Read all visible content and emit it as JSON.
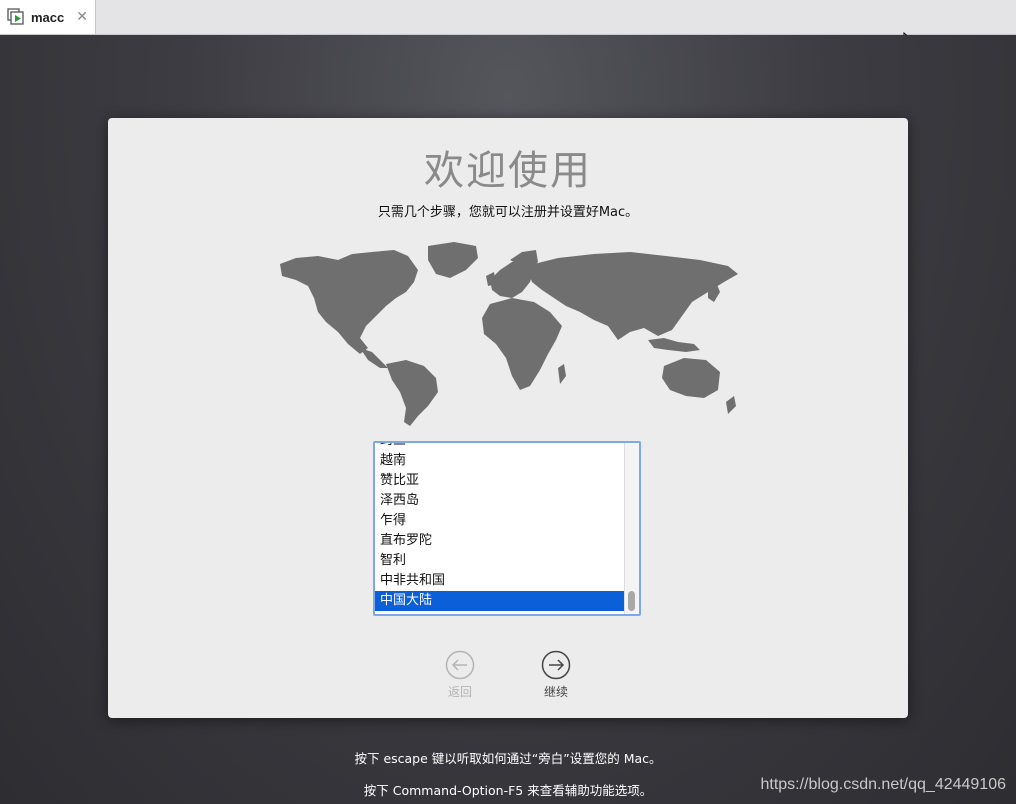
{
  "tab": {
    "title": "macc",
    "close": "✕"
  },
  "panel": {
    "title": "欢迎使用",
    "subtitle": "只需几个步骤，您就可以注册并设置好Mac。"
  },
  "countries": [
    {
      "label": "约旦",
      "selected": false
    },
    {
      "label": "越南",
      "selected": false
    },
    {
      "label": "赞比亚",
      "selected": false
    },
    {
      "label": "泽西岛",
      "selected": false
    },
    {
      "label": "乍得",
      "selected": false
    },
    {
      "label": "直布罗陀",
      "selected": false
    },
    {
      "label": "智利",
      "selected": false
    },
    {
      "label": "中非共和国",
      "selected": false
    },
    {
      "label": "中国大陆",
      "selected": true
    }
  ],
  "nav": {
    "back_label": "返回",
    "next_label": "继续"
  },
  "hints": {
    "line1": "按下 escape 键以听取如何通过“旁白”设置您的 Mac。",
    "line2": "按下 Command-Option-F5 来查看辅助功能选项。"
  },
  "watermark": "https://blog.csdn.net/qq_42449106",
  "colors": {
    "selection": "#0b5fd8",
    "list_border": "#7fa6e8",
    "tab_icon_green": "#2e9b3a"
  }
}
